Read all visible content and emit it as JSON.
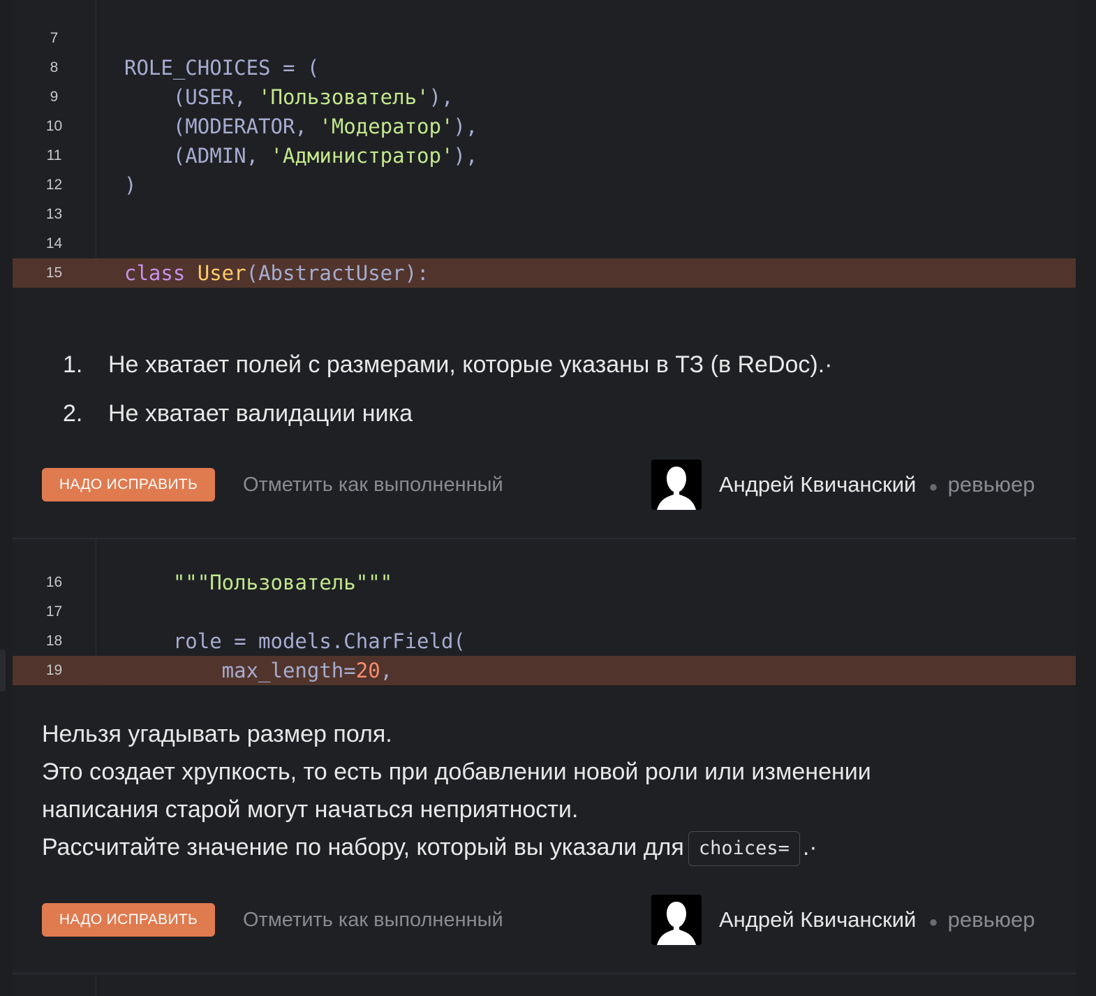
{
  "block1": {
    "lines": [
      {
        "num": "7",
        "segments": []
      },
      {
        "num": "8",
        "segments": [
          {
            "t": "ROLE_CHOICES = (",
            "c": "p"
          }
        ]
      },
      {
        "num": "9",
        "segments": [
          {
            "t": "    (USER, ",
            "c": "p"
          },
          {
            "t": "'Пользователь'",
            "c": "s"
          },
          {
            "t": "),",
            "c": "p"
          }
        ]
      },
      {
        "num": "10",
        "segments": [
          {
            "t": "    (MODERATOR, ",
            "c": "p"
          },
          {
            "t": "'Модератор'",
            "c": "s"
          },
          {
            "t": "),",
            "c": "p"
          }
        ]
      },
      {
        "num": "11",
        "segments": [
          {
            "t": "    (ADMIN, ",
            "c": "p"
          },
          {
            "t": "'Администратор'",
            "c": "s"
          },
          {
            "t": "),",
            "c": "p"
          }
        ]
      },
      {
        "num": "12",
        "segments": [
          {
            "t": ")",
            "c": "p"
          }
        ]
      },
      {
        "num": "13",
        "segments": []
      },
      {
        "num": "14",
        "segments": []
      },
      {
        "num": "15",
        "highlight": true,
        "segments": [
          {
            "t": "class ",
            "c": "k"
          },
          {
            "t": "User",
            "c": "c"
          },
          {
            "t": "(AbstractUser):",
            "c": "p"
          }
        ]
      }
    ]
  },
  "comment1": {
    "items": [
      {
        "num": "1.",
        "text": "Не хватает полей с размерами, которые указаны в ТЗ (в ReDoc).·"
      },
      {
        "num": "2.",
        "text": "Не хватает валидации ника"
      }
    ]
  },
  "footer1": {
    "fix_label": "НАДО ИСПРАВИТЬ",
    "mark_label": "Отметить как выполненный",
    "author": "Андрей Квичанский",
    "role": "ревьюер"
  },
  "block2": {
    "lines": [
      {
        "num": "16",
        "segments": [
          {
            "t": "    ",
            "c": "p"
          },
          {
            "t": "\"\"\"Пользователь\"\"\"",
            "c": "s"
          }
        ]
      },
      {
        "num": "17",
        "segments": []
      },
      {
        "num": "18",
        "segments": [
          {
            "t": "    role = models.CharField(",
            "c": "p"
          }
        ]
      },
      {
        "num": "19",
        "highlight": true,
        "segments": [
          {
            "t": "        max_length=",
            "c": "p"
          },
          {
            "t": "20",
            "c": "n"
          },
          {
            "t": ",",
            "c": "p"
          }
        ]
      }
    ]
  },
  "comment2": {
    "line1": "Нельзя угадывать размер поля.",
    "line2": "Это создает хрупкость, то есть при добавлении новой роли или изменении",
    "line3": "написания старой могут начаться неприятности.",
    "line4_text": "Рассчитайте значение по набору, который вы указали для",
    "line4_code": "choices=",
    "line4_end": ".·"
  },
  "footer2": {
    "fix_label": "НАДО ИСПРАВИТЬ",
    "mark_label": "Отметить как выполненный",
    "author": "Андрей Квичанский",
    "role": "ревьюер"
  },
  "colors": {
    "highlight_row": "#51342b",
    "fix_button": "#e07a4f",
    "string": "#c3e88d",
    "keyword": "#c792ea",
    "class_name": "#ffcb6b",
    "number": "#f78c6c"
  },
  "icons": {
    "avatar": "user-silhouette-icon"
  }
}
